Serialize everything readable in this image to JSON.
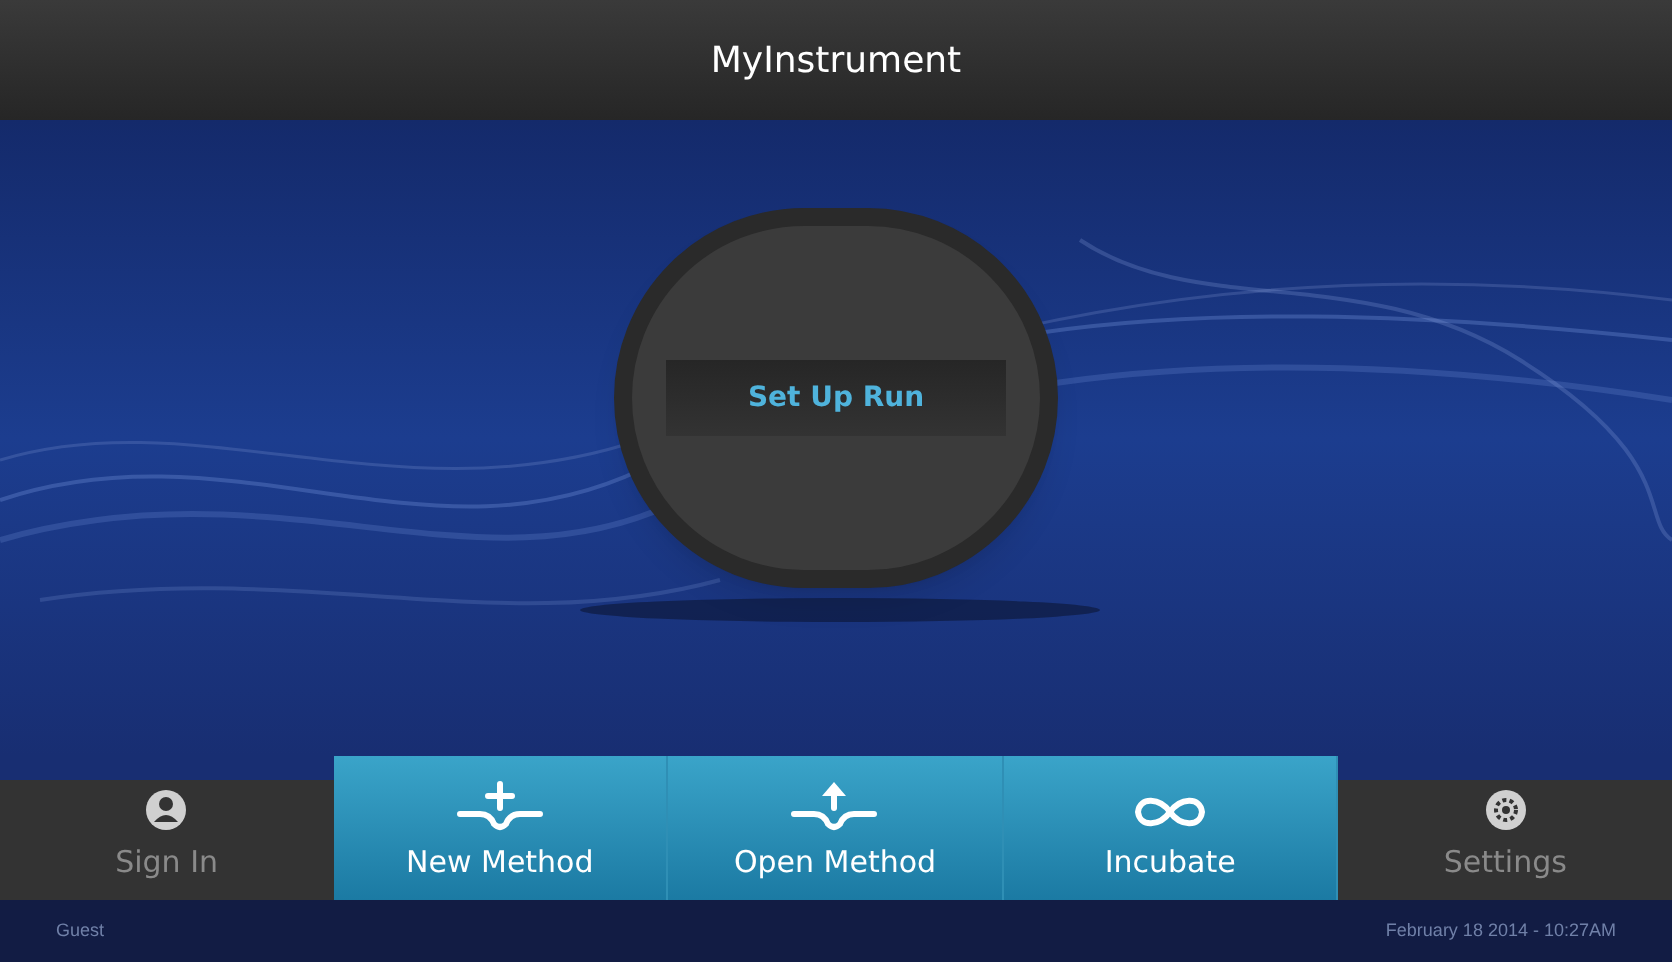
{
  "window": {
    "title": "MyInstrument"
  },
  "main_button": {
    "label": "Set Up Run"
  },
  "nav": [
    {
      "label": "Sign In",
      "kind": "user",
      "highlighted": false
    },
    {
      "label": "New Method",
      "kind": "new",
      "highlighted": true
    },
    {
      "label": "Open Method",
      "kind": "open",
      "highlighted": true
    },
    {
      "label": "Incubate",
      "kind": "infinity",
      "highlighted": true
    },
    {
      "label": "Settings",
      "kind": "gear",
      "highlighted": false
    }
  ],
  "status_bar": {
    "user": "Guest",
    "datetime": "February 18 2014 - 10:27AM"
  }
}
